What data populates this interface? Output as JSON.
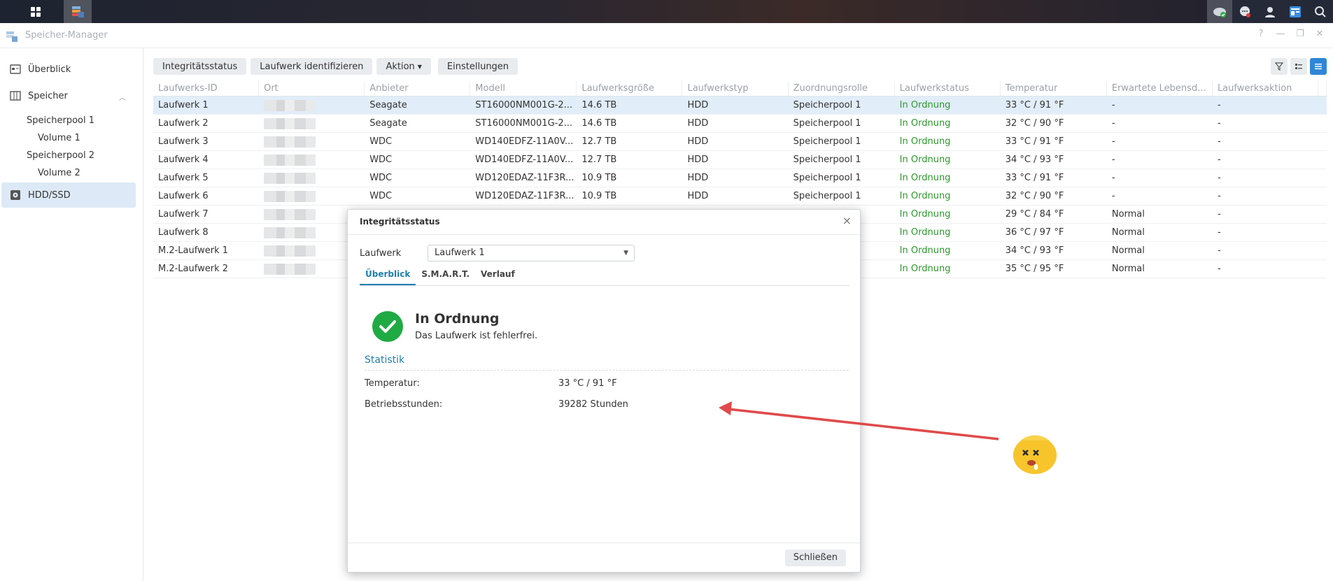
{
  "window": {
    "title": "Speicher-Manager"
  },
  "sidebar": {
    "overview": "Überblick",
    "storage": "Speicher",
    "pool1": "Speicherpool 1",
    "volume1": "Volume 1",
    "pool2": "Speicherpool 2",
    "volume2": "Volume 2",
    "hdd": "HDD/SSD"
  },
  "toolbar": {
    "integrity": "Integritätsstatus",
    "identify": "Laufwerk identifizieren",
    "action": "Aktion",
    "settings": "Einstellungen"
  },
  "table": {
    "headers": [
      "Laufwerks-ID",
      "Ort",
      "Anbieter",
      "Modell",
      "Laufwerksgröße",
      "Laufwerkstyp",
      "Zuordnungsrolle",
      "Laufwerkstatus",
      "Temperatur",
      "Erwartete Lebensd...",
      "Laufwerksaktion"
    ],
    "rows": [
      [
        "Laufwerk 1",
        "",
        "Seagate",
        "ST16000NM001G-2...",
        "14.6 TB",
        "HDD",
        "Speicherpool 1",
        "In Ordnung",
        "33 °C / 91 °F",
        "-",
        "-"
      ],
      [
        "Laufwerk 2",
        "",
        "Seagate",
        "ST16000NM001G-2...",
        "14.6 TB",
        "HDD",
        "Speicherpool 1",
        "In Ordnung",
        "32 °C / 90 °F",
        "-",
        "-"
      ],
      [
        "Laufwerk 3",
        "",
        "WDC",
        "WD140EDFZ-11A0V...",
        "12.7 TB",
        "HDD",
        "Speicherpool 1",
        "In Ordnung",
        "33 °C / 91 °F",
        "-",
        "-"
      ],
      [
        "Laufwerk 4",
        "",
        "WDC",
        "WD140EDFZ-11A0V...",
        "12.7 TB",
        "HDD",
        "Speicherpool 1",
        "In Ordnung",
        "34 °C / 93 °F",
        "-",
        "-"
      ],
      [
        "Laufwerk 5",
        "",
        "WDC",
        "WD120EDAZ-11F3R...",
        "10.9 TB",
        "HDD",
        "Speicherpool 1",
        "In Ordnung",
        "33 °C / 91 °F",
        "-",
        "-"
      ],
      [
        "Laufwerk 6",
        "",
        "WDC",
        "WD120EDAZ-11F3R...",
        "10.9 TB",
        "HDD",
        "Speicherpool 1",
        "In Ordnung",
        "32 °C / 90 °F",
        "-",
        "-"
      ],
      [
        "Laufwerk 7",
        "",
        "",
        "",
        "",
        "",
        "2",
        "In Ordnung",
        "29 °C / 84 °F",
        "Normal",
        "-"
      ],
      [
        "Laufwerk 8",
        "",
        "",
        "",
        "",
        "",
        "2",
        "In Ordnung",
        "36 °C / 97 °F",
        "Normal",
        "-"
      ],
      [
        "M.2-Laufwerk 1",
        "",
        "",
        "",
        "",
        "",
        "uppe 1",
        "In Ordnung",
        "34 °C / 93 °F",
        "Normal",
        "-"
      ],
      [
        "M.2-Laufwerk 2",
        "",
        "",
        "",
        "",
        "",
        "uppe 1",
        "In Ordnung",
        "35 °C / 95 °F",
        "Normal",
        "-"
      ]
    ]
  },
  "dialog": {
    "title": "Integritätsstatus",
    "drive_label": "Laufwerk",
    "drive_value": "Laufwerk 1",
    "tabs": [
      "Überblick",
      "S.M.A.R.T.",
      "Verlauf"
    ],
    "status_title": "In Ordnung",
    "status_sub": "Das Laufwerk ist fehlerfrei.",
    "stats_heading": "Statistik",
    "temp_label": "Temperatur:",
    "temp_value": "33 °C / 91 °F",
    "hours_label": "Betriebsstunden:",
    "hours_value": "39282 Stunden",
    "close": "Schließen"
  },
  "colors": {
    "accent": "#1f7fb0",
    "ok": "#2b9a2b",
    "arrow": "#e04a4a",
    "emoji": "#f7c52b"
  }
}
